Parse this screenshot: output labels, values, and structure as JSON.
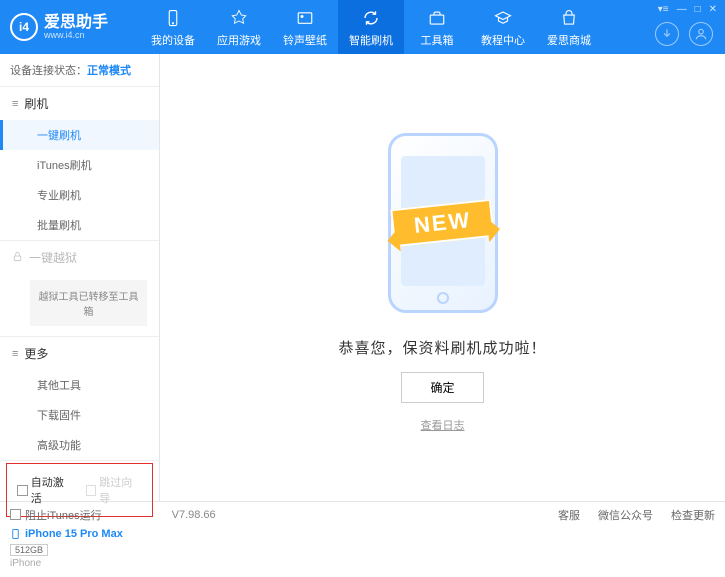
{
  "app": {
    "title": "爱思助手",
    "subtitle": "www.i4.cn"
  },
  "nav": {
    "items": [
      {
        "label": "我的设备"
      },
      {
        "label": "应用游戏"
      },
      {
        "label": "铃声壁纸"
      },
      {
        "label": "智能刷机"
      },
      {
        "label": "工具箱"
      },
      {
        "label": "教程中心"
      },
      {
        "label": "爱思商城"
      }
    ]
  },
  "sidebar": {
    "status_label": "设备连接状态：",
    "status_mode": "正常模式",
    "sections": {
      "flash": {
        "title": "刷机",
        "items": [
          "一键刷机",
          "iTunes刷机",
          "专业刷机",
          "批量刷机"
        ]
      },
      "jailbreak": {
        "title": "一键越狱",
        "note": "越狱工具已转移至工具箱"
      },
      "more": {
        "title": "更多",
        "items": [
          "其他工具",
          "下载固件",
          "高级功能"
        ]
      }
    },
    "checkbox1": "自动激活",
    "checkbox2": "跳过向导",
    "device": {
      "name": "iPhone 15 Pro Max",
      "storage": "512GB",
      "type": "iPhone"
    }
  },
  "main": {
    "banner": "NEW",
    "success": "恭喜您，保资料刷机成功啦！",
    "ok": "确定",
    "log": "查看日志"
  },
  "footer": {
    "block_itunes": "阻止iTunes运行",
    "version": "V7.98.66",
    "links": [
      "客服",
      "微信公众号",
      "检查更新"
    ]
  }
}
